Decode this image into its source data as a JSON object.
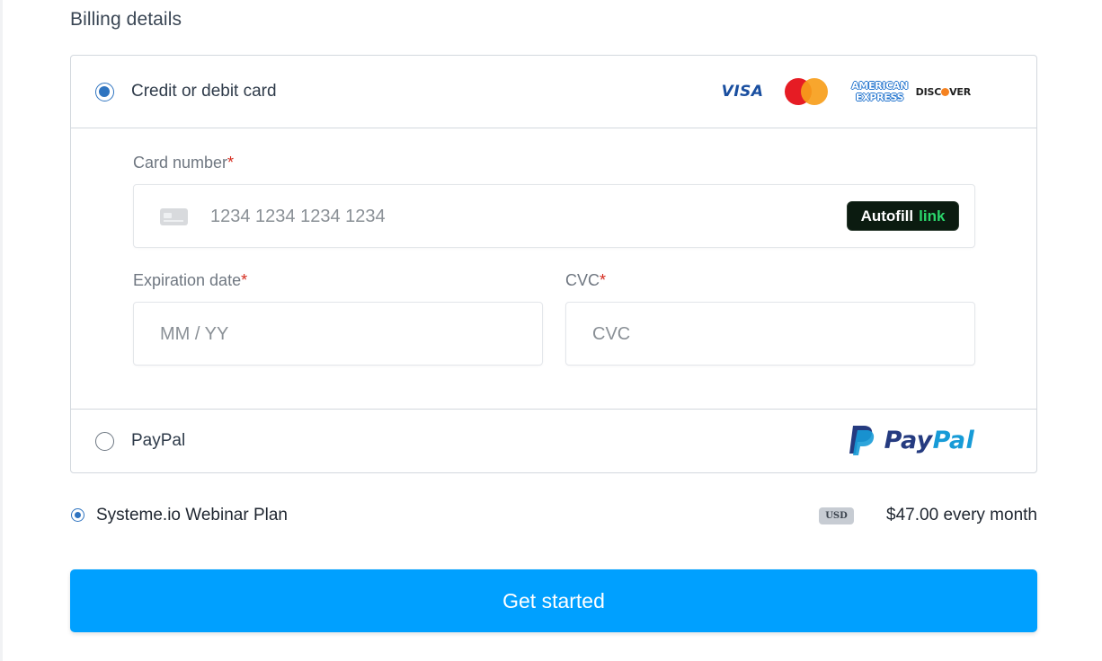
{
  "section": {
    "title": "Billing details"
  },
  "payment_methods": {
    "card": {
      "label": "Credit or debit card",
      "selected": true,
      "brands": [
        "VISA",
        "Mastercard",
        "American Express",
        "DISCOVER"
      ],
      "visa_text": "VISA",
      "amex_line1": "AMERICAN",
      "amex_line2": "EXPRESS",
      "discover_pre": "DISC",
      "discover_post": "VER"
    },
    "paypal": {
      "label": "PayPal",
      "selected": false,
      "logo_pay": "Pay",
      "logo_pal": "Pal"
    }
  },
  "card_form": {
    "card_number": {
      "label": "Card number",
      "required_mark": "*",
      "placeholder": "1234 1234 1234 1234"
    },
    "autofill": {
      "label": "Autofill",
      "link_label": "link"
    },
    "expiration": {
      "label": "Expiration date",
      "required_mark": "*",
      "placeholder": "MM / YY"
    },
    "cvc": {
      "label": "CVC",
      "required_mark": "*",
      "placeholder": "CVC"
    }
  },
  "plan": {
    "name": "Systeme.io Webinar Plan",
    "currency": "USD",
    "price": "$47.00 every month",
    "selected": true
  },
  "cta": {
    "label": "Get started"
  },
  "colors": {
    "accent": "#2f74c0",
    "cta_bg": "#00a0ff",
    "required": "#d52b1e",
    "link_green": "#2bd66b"
  }
}
